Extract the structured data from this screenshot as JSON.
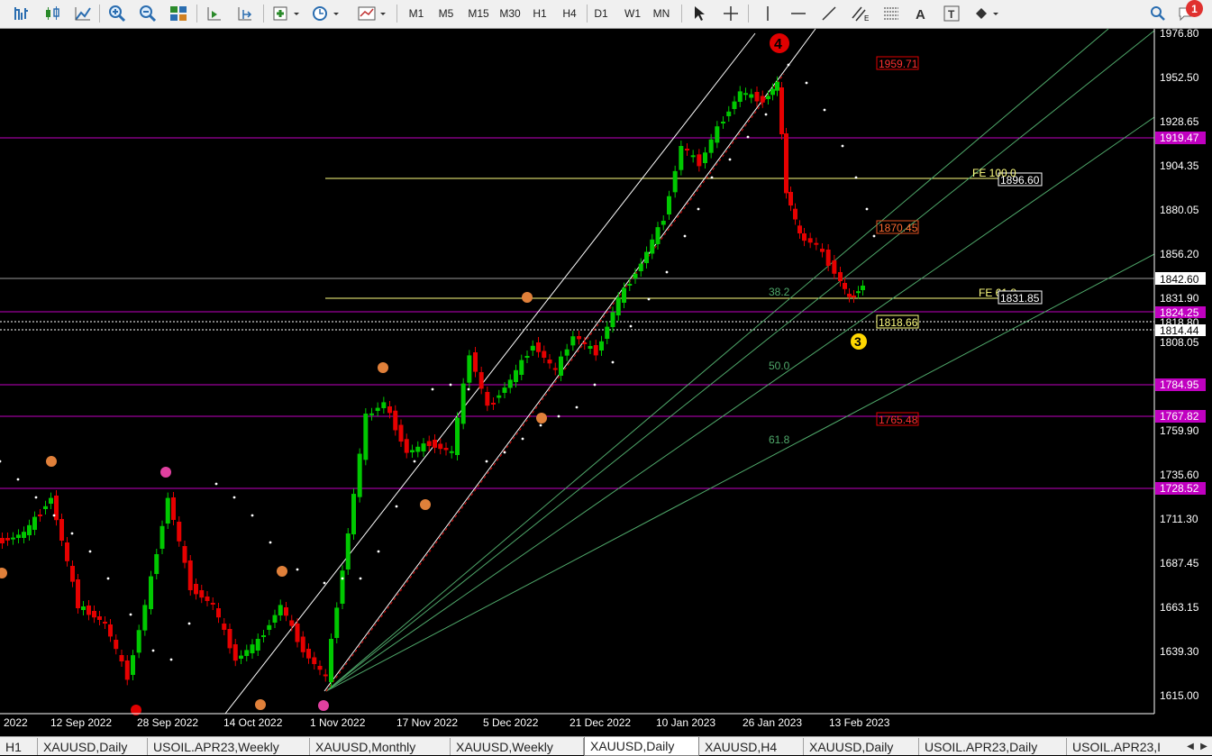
{
  "toolbar": {
    "timeframes": [
      "M1",
      "M5",
      "M15",
      "M30",
      "H1",
      "H4",
      "D1",
      "W1",
      "MN"
    ],
    "notification_count": "1"
  },
  "chart": {
    "price_ticks": [
      "1976.80",
      "1952.50",
      "1928.65",
      "1904.35",
      "1880.05",
      "1856.20",
      "1831.90",
      "1808.05",
      "1759.90",
      "1735.60",
      "1711.30",
      "1687.45",
      "1663.15",
      "1639.30",
      "1615.00"
    ],
    "date_ticks": [
      "2022",
      "12 Sep 2022",
      "28 Sep 2022",
      "14 Oct 2022",
      "1 Nov 2022",
      "17 Nov 2022",
      "5 Dec 2022",
      "21 Dec 2022",
      "10 Jan 2023",
      "26 Jan 2023",
      "13 Feb 2023"
    ],
    "level_tags": {
      "l1919": "1919.47",
      "l1842": "1842.60",
      "l1824": "1824.25",
      "l1818": "1818.80",
      "l1814": "1814.44",
      "l1784": "1784.95",
      "l1767": "1767.82",
      "l1728": "1728.52"
    },
    "inline_labels": {
      "p1959": "1959.71",
      "p1896": "1896.60",
      "p1870": "1870.45",
      "p1831": "1831.85",
      "p1818": "1818.66",
      "p1765": "1765.48",
      "fe100": "FE 100.0",
      "fe618": "FE 61.8",
      "fib382": "38.2",
      "fib50": "50.0",
      "fib618": "61.8"
    },
    "wave_labels": {
      "w4": "4",
      "w3": "3"
    },
    "colors": {
      "bull": "#00c800",
      "bear": "#e60000",
      "level": "#c000c0",
      "fib": "#ffff80",
      "fan": "#4fa86a"
    }
  },
  "tabs": [
    {
      "label": "H1"
    },
    {
      "label": "XAUUSD,Daily"
    },
    {
      "label": "USOIL.APR23,Weekly"
    },
    {
      "label": "XAUUSD,Monthly"
    },
    {
      "label": "XAUUSD,Weekly"
    },
    {
      "label": "XAUUSD,Daily",
      "active": true
    },
    {
      "label": "XAUUSD,H4"
    },
    {
      "label": "XAUUSD,Daily"
    },
    {
      "label": "USOIL.APR23,Daily"
    },
    {
      "label": "USOIL.APR23,I"
    }
  ]
}
